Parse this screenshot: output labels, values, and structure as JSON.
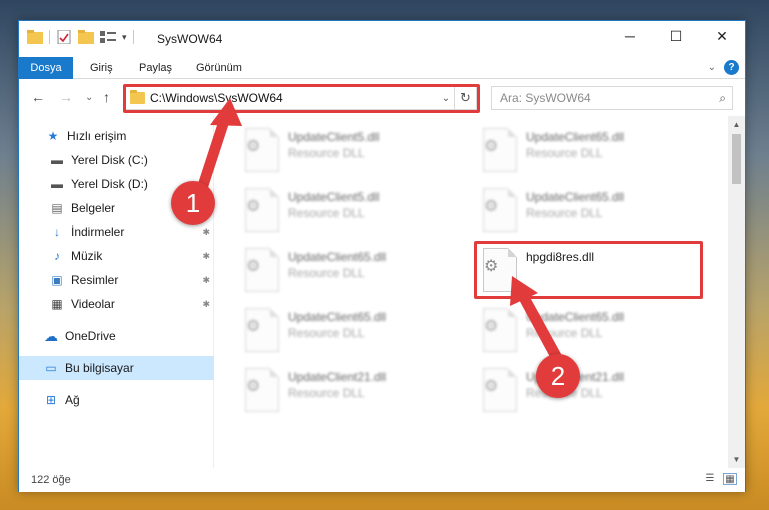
{
  "window": {
    "title": "SysWOW64"
  },
  "controls": {
    "minimize": "─",
    "maximize": "☐",
    "close": "✕"
  },
  "ribbon": {
    "tabs": [
      "Dosya",
      "Giriş",
      "Paylaş",
      "Görünüm"
    ],
    "help": "?",
    "expand": "⌄"
  },
  "nav": {
    "back": "←",
    "forward": "→",
    "recent": "⌄",
    "up": "↑",
    "path": "C:\\Windows\\SysWOW64",
    "dropdown": "⌄",
    "refresh": "↻",
    "search_placeholder": "Ara: SysWOW64",
    "search_icon": "⌕"
  },
  "sidebar": {
    "items": [
      {
        "label": "Hızlı erişim",
        "icon": "quick-access-star",
        "glyph": "★",
        "pinned": false
      },
      {
        "label": "Yerel Disk (C:)",
        "icon": "drive",
        "glyph": "▬",
        "pinned": false
      },
      {
        "label": "Yerel Disk (D:)",
        "icon": "drive",
        "glyph": "▬",
        "pinned": false
      },
      {
        "label": "Belgeler",
        "icon": "documents",
        "glyph": "▤",
        "pinned": true
      },
      {
        "label": "İndirmeler",
        "icon": "downloads",
        "glyph": "↓",
        "pinned": true
      },
      {
        "label": "Müzik",
        "icon": "music",
        "glyph": "♪",
        "pinned": true
      },
      {
        "label": "Resimler",
        "icon": "pictures",
        "glyph": "▣",
        "pinned": true
      },
      {
        "label": "Videolar",
        "icon": "videos",
        "glyph": "▦",
        "pinned": true
      },
      {
        "label": "OneDrive",
        "icon": "onedrive-cloud",
        "glyph": "☁",
        "pinned": false
      },
      {
        "label": "Bu bilgisayar",
        "icon": "this-pc",
        "glyph": "▭",
        "pinned": false
      },
      {
        "label": "Ağ",
        "icon": "network",
        "glyph": "⊞",
        "pinned": false
      }
    ],
    "pin_glyph": "✱"
  },
  "files": [
    {
      "name": "UpdateClient5.dll",
      "type": "Resource DLL"
    },
    {
      "name": "UpdateClient65.dll",
      "type": "Resource DLL"
    },
    {
      "name": "UpdateClient5.dll",
      "type": "Resource DLL"
    },
    {
      "name": "UpdateClient65.dll",
      "type": "Resource DLL"
    },
    {
      "name": "UpdateClient65.dll",
      "type": "Resource DLL"
    },
    {
      "name": "hpgdi8res.dll",
      "type": ""
    },
    {
      "name": "UpdateClient65.dll",
      "type": "Resource DLL"
    },
    {
      "name": "UpdateClient65.dll",
      "type": "Resource DLL"
    },
    {
      "name": "UpdateClient21.dll",
      "type": "Resource DLL"
    },
    {
      "name": "UpdateClient21.dll",
      "type": "Resource DLL"
    }
  ],
  "status": {
    "count": "122 öğe"
  },
  "callouts": {
    "one": "1",
    "two": "2"
  },
  "colors": {
    "accent": "#1979ca",
    "highlight": "#e23b3b",
    "selected": "#cce8ff"
  }
}
